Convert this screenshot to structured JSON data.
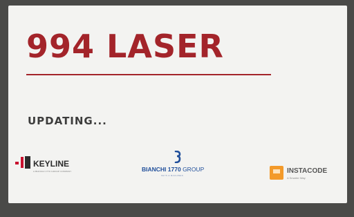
{
  "screen": {
    "title": "994 LASER",
    "status": "UPDATING..."
  },
  "brands": {
    "keyline": {
      "name": "KEYLINE",
      "tagline": "A BIANCHI 1770 GROUP COMPANY"
    },
    "bianchi": {
      "name": "BIANCHI 1770",
      "name_suffix": "GROUP",
      "tagline": "KEYS & MACHINES"
    },
    "instacode": {
      "name": "INSTACODE",
      "tagline": "A Smarter Way"
    }
  },
  "colors": {
    "title": "#a3242a",
    "keyline_red": "#c8102e",
    "bianchi_blue": "#1f4e9a",
    "instacode_orange": "#f39a2a"
  }
}
